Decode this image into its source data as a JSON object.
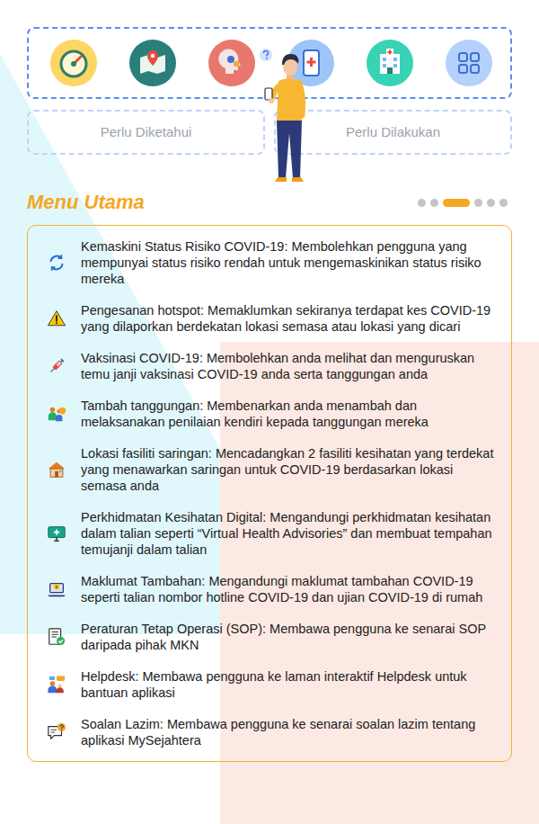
{
  "tabs": [
    {
      "label": "Perlu Diketahui"
    },
    {
      "label": "Perlu Dilakukan"
    }
  ],
  "menu": {
    "title": "Menu Utama",
    "pager": [
      {
        "selected": false
      },
      {
        "selected": false
      },
      {
        "selected": true
      },
      {
        "selected": false
      },
      {
        "selected": false
      },
      {
        "selected": false
      }
    ],
    "items": [
      {
        "text": "Kemaskini Status Risiko COVID-19: Membolehkan pengguna yang mempunyai status risiko rendah untuk mengemaskinikan status risiko mereka"
      },
      {
        "text": "Pengesanan hotspot: Memaklumkan sekiranya terdapat kes COVID-19 yang dilaporkan berdekatan lokasi semasa atau lokasi yang dicari"
      },
      {
        "text": "Vaksinasi COVID-19: Membolehkan anda melihat dan menguruskan temu janji vaksinasi COVID-19 anda serta tanggungan anda"
      },
      {
        "text": "Tambah tanggungan: Membenarkan anda menambah dan melaksanakan penilaian kendiri kepada tanggungan mereka"
      },
      {
        "text": "Lokasi fasiliti saringan: Mencadangkan 2 fasiliti kesihatan yang terdekat yang menawarkan saringan untuk COVID-19 berdasarkan lokasi semasa anda"
      },
      {
        "text": "Perkhidmatan Kesihatan Digital: Mengandungi perkhidmatan kesihatan dalam talian seperti “Virtual Health Advisories” dan membuat tempahan temujanji dalam talian"
      },
      {
        "text": "Maklumat Tambahan: Mengandungi maklumat tambahan COVID-19 seperti talian nombor hotline COVID-19 dan ujian COVID-19 di rumah"
      },
      {
        "text": "Peraturan Tetap Operasi (SOP): Membawa pengguna ke senarai SOP daripada pihak MKN"
      },
      {
        "text": "Helpdesk: Membawa pengguna ke laman interaktif Helpdesk untuk bantuan aplikasi"
      },
      {
        "text": "Soalan Lazim: Membawa pengguna ke senarai soalan lazim tentang aplikasi MySejahtera"
      }
    ]
  }
}
